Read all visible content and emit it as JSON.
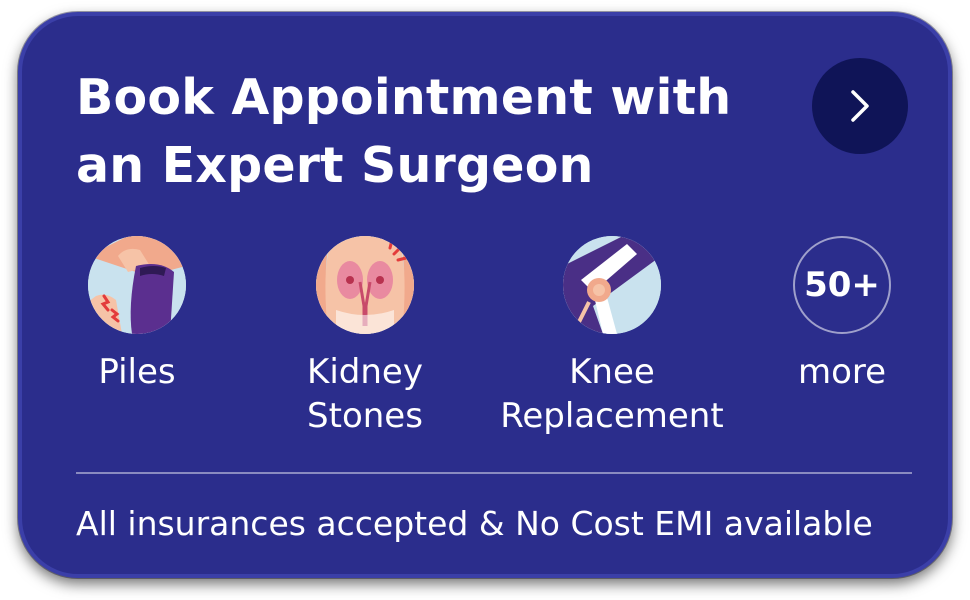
{
  "card": {
    "title_line1": "Book Appointment with",
    "title_line2": "an Expert Surgeon",
    "footer_text": "All insurances accepted & No Cost EMI available"
  },
  "procedures": [
    {
      "label": "Piles",
      "icon": "piles-icon"
    },
    {
      "label": "Kidney\nStones",
      "icon": "kidney-stones-icon"
    },
    {
      "label": "Knee\nReplacement",
      "icon": "knee-replacement-icon"
    }
  ],
  "more": {
    "count": "50+",
    "label": "more"
  },
  "colors": {
    "card_background": "#2b2d8c",
    "arrow_button": "#0f1457",
    "text": "#ffffff"
  }
}
